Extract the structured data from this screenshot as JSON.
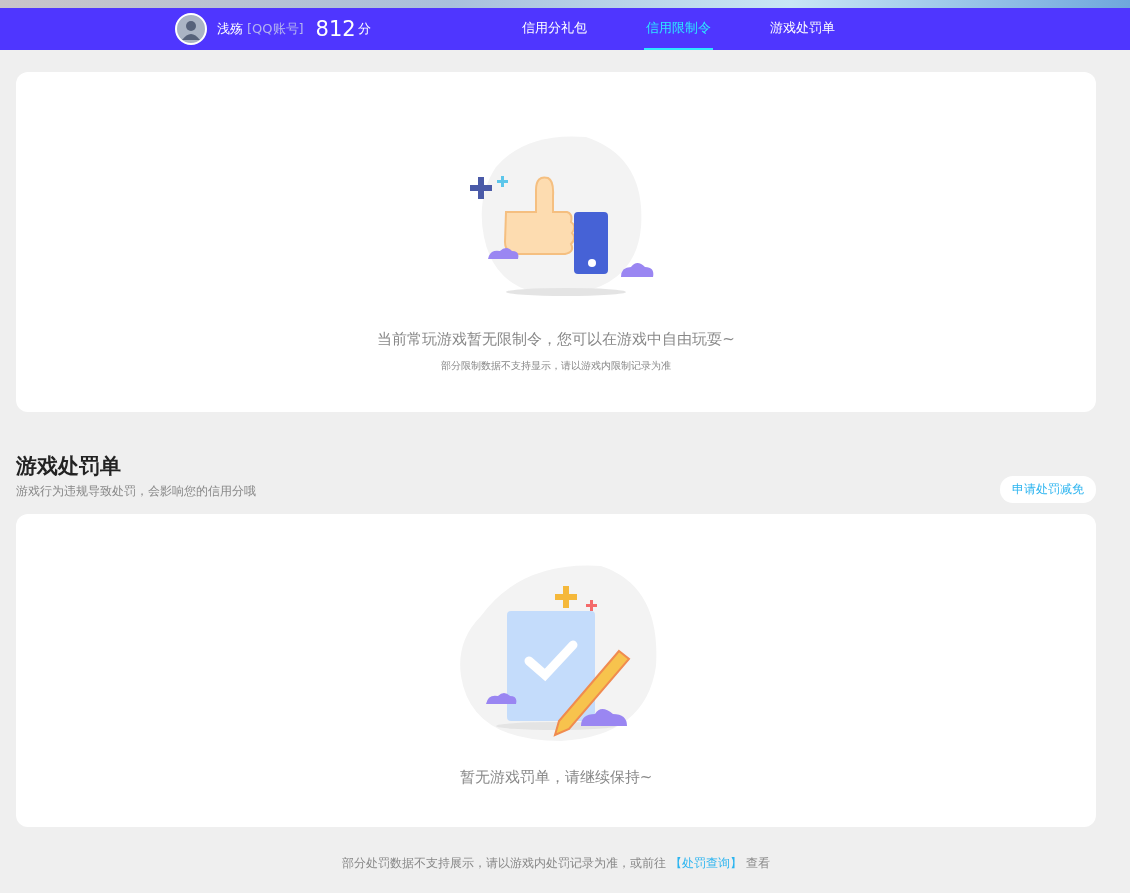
{
  "header": {
    "user_name": "浅殇",
    "account_type": "[QQ账号]",
    "score": "812",
    "score_unit": "分",
    "tabs": [
      {
        "label": "信用分礼包",
        "selected": false
      },
      {
        "label": "信用限制令",
        "selected": true
      },
      {
        "label": "游戏处罚单",
        "selected": false
      }
    ]
  },
  "restrictions": {
    "message": "当前常玩游戏暂无限制令，您可以在游戏中自由玩耍~",
    "note": "部分限制数据不支持显示，请以游戏内限制记录为准"
  },
  "penalties": {
    "title": "游戏处罚单",
    "subtitle": "游戏行为违规导致处罚，会影响您的信用分哦",
    "action": "申请处罚减免",
    "message": "暂无游戏罚单，请继续保持~"
  },
  "footer": {
    "text": "部分处罚数据不支持展示，请以游戏内处罚记录为准，或前往",
    "link": "【处罚查询】",
    "suffix": "查看"
  }
}
